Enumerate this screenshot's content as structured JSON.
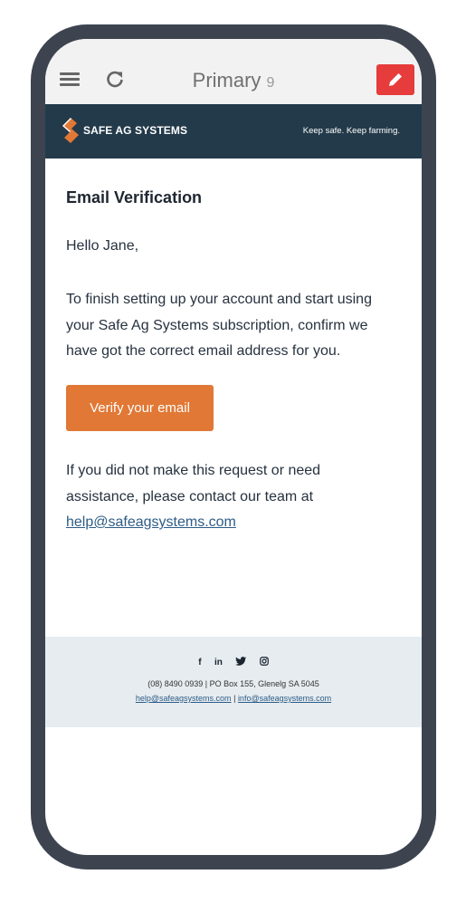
{
  "app_bar": {
    "title": "Primary",
    "unread_count": "9",
    "icons": {
      "menu": "menu-icon",
      "refresh": "refresh-icon",
      "compose": "pencil-icon"
    },
    "compose_color": "#e63c3c"
  },
  "brand": {
    "logo_text": "SAFE AG SYSTEMS",
    "tagline": "Keep safe. Keep farming.",
    "bar_color": "#233a4a",
    "logo_accent": "#e17835"
  },
  "email": {
    "heading": "Email Verification",
    "greeting": "Hello Jane,",
    "body": "To finish setting up your account and start using your Safe Ag Systems subscription, confirm we have got the correct email address for you.",
    "button_label": "Verify your email",
    "button_color": "#e17835",
    "help_text": "If you did not make this request or need assistance, please contact our team at",
    "help_email": "help@safeagsystems.com"
  },
  "footer": {
    "social": [
      {
        "icon": "facebook-icon",
        "glyph": "f"
      },
      {
        "icon": "linkedin-icon",
        "glyph": "in"
      },
      {
        "icon": "twitter-icon",
        "glyph": "t"
      },
      {
        "icon": "instagram-icon",
        "glyph": "o"
      }
    ],
    "address": "(08) 8490 0939  |  PO Box 155, Glenelg SA 5045",
    "help_link": "help@safeagsystems.com",
    "separator": "|",
    "info_link": "info@safeagsystems.com"
  }
}
